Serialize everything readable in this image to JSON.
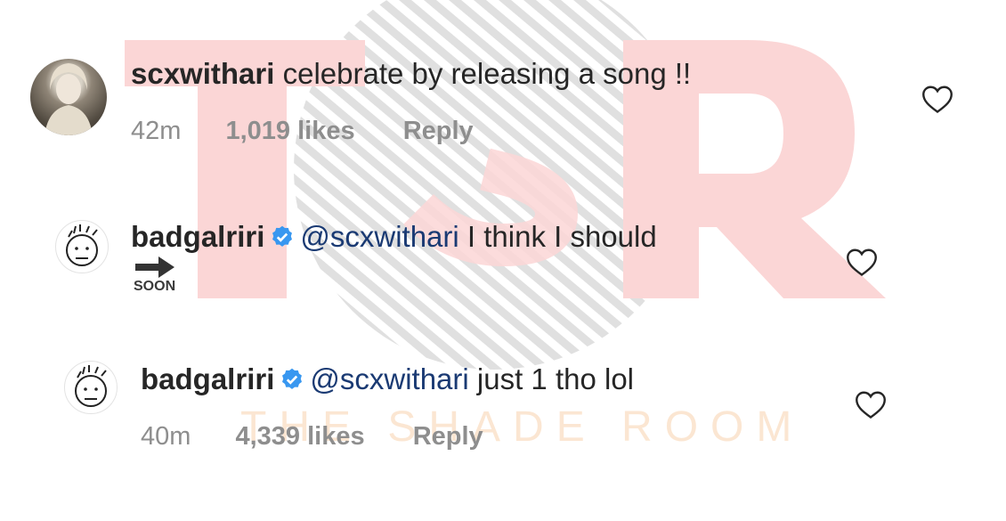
{
  "watermark": {
    "letters": "TSR",
    "brand": "THE SHADE ROOM"
  },
  "comments": [
    {
      "username": "scxwithari",
      "text": "celebrate by releasing a song !!",
      "time": "42m",
      "likes": "1,019 likes",
      "reply": "Reply",
      "avatar": "photo-avatar"
    },
    {
      "username": "badgalriri",
      "verified": true,
      "mention": "@scxwithari",
      "text": "I think I should",
      "sticker_label": "SOON",
      "avatar": "doodle-avatar"
    },
    {
      "username": "badgalriri",
      "verified": true,
      "mention": "@scxwithari",
      "text": "just 1 tho lol",
      "time": "40m",
      "likes": "4,339 likes",
      "reply": "Reply",
      "avatar": "doodle-avatar"
    }
  ],
  "colors": {
    "mention": "#1a3a73",
    "verified_badge": "#3897f0",
    "meta_text": "#8e8e8e",
    "watermark_pink": "#fbd6d6",
    "watermark_orange": "#fbe6d2"
  }
}
